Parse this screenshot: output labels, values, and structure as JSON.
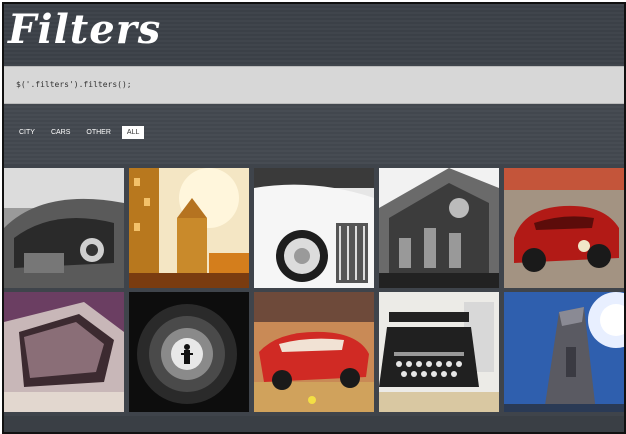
{
  "header": {
    "title": "Filters"
  },
  "code": {
    "text": "$('.filters').filters();"
  },
  "filters": {
    "items": [
      {
        "label": "CITY"
      },
      {
        "label": "CARS"
      },
      {
        "label": "OTHER"
      },
      {
        "label": "ALL",
        "active": true
      }
    ]
  },
  "gallery": {
    "tiles": [
      {
        "subject": "convertible-car-interior",
        "style": "grayscale"
      },
      {
        "subject": "city-buildings-sunset",
        "style": "warm"
      },
      {
        "subject": "classic-car-headlight",
        "style": "grayscale"
      },
      {
        "subject": "ornate-building-facade",
        "style": "grayscale"
      },
      {
        "subject": "red-vintage-racecar",
        "style": "color"
      },
      {
        "subject": "car-door-window",
        "style": "violet"
      },
      {
        "subject": "tunnel-silhouette",
        "style": "grayscale"
      },
      {
        "subject": "red-convertible-street",
        "style": "color"
      },
      {
        "subject": "vintage-typewriter",
        "style": "color"
      },
      {
        "subject": "blue-sky-monument",
        "style": "blue"
      }
    ]
  },
  "colors": {
    "background": "#3f444b",
    "code_box": "#d7d7d7",
    "active_filter_bg": "#ffffff"
  }
}
